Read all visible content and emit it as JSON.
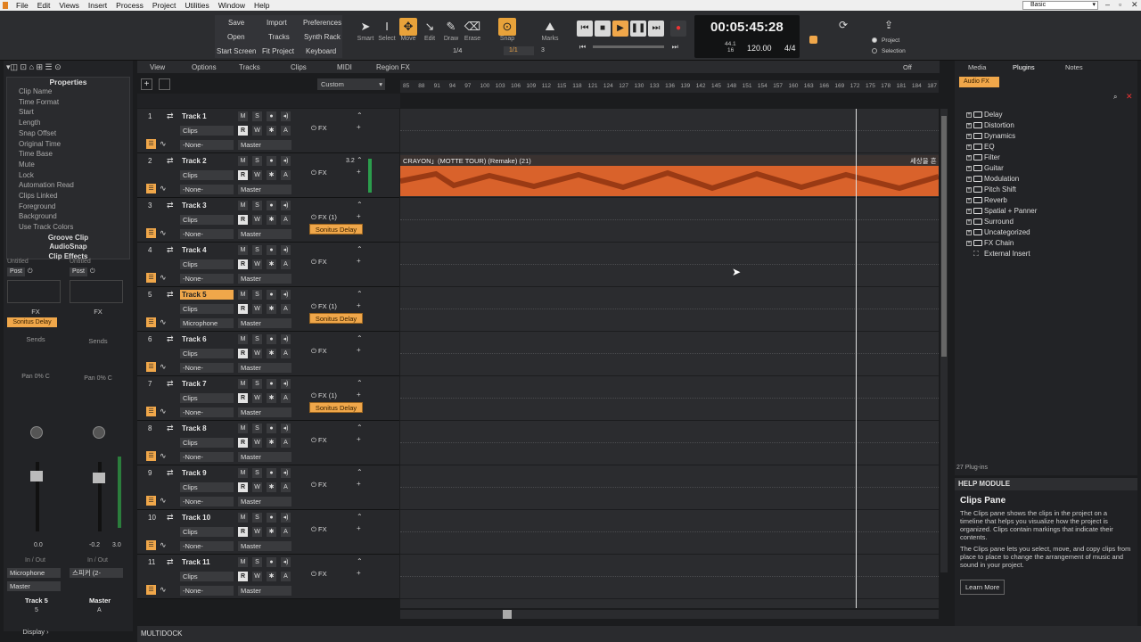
{
  "menu": [
    "File",
    "Edit",
    "Views",
    "Insert",
    "Process",
    "Project",
    "Utilities",
    "Window",
    "Help"
  ],
  "workspace": "Basic",
  "toolbar": {
    "buttons": {
      "save": "Save",
      "import": "Import",
      "preferences": "Preferences",
      "open": "Open",
      "tracks": "Tracks",
      "synth_rack": "Synth Rack",
      "start_screen": "Start Screen",
      "fit_project": "Fit Project",
      "keyboard": "Keyboard"
    },
    "tools": [
      "Smart",
      "Select",
      "Move",
      "Edit",
      "Draw",
      "Erase"
    ],
    "snap_label": "Snap",
    "snap_value": "1/4",
    "snap_value2": "1/1",
    "snap_num": "3",
    "markers_label": "Marks",
    "time": "00:05:45:28",
    "sample_rate": "44.1",
    "bit_depth": "16",
    "tempo": "120.00",
    "meter": "4/4",
    "project_label": "Project",
    "selection_label": "Selection"
  },
  "inspector": {
    "heading": "Properties",
    "properties": [
      "Clip Name",
      "Time Format",
      "Start",
      "Length",
      "Snap Offset",
      "Original Time",
      "Time Base",
      "Mute",
      "Lock",
      "Automation Read",
      "Clips Linked",
      "Foreground",
      "Background",
      "Use Track Colors"
    ],
    "sections": [
      "Groove Clip",
      "AudioSnap",
      "Clip Effects"
    ],
    "strip1": {
      "title": "Untitled",
      "post": "Post",
      "fx": "FX",
      "plugin": "Sonitus Delay",
      "sends": "Sends",
      "pan_label": "Pan",
      "pan_value": "0% C",
      "vol": "0.0",
      "io": "In / Out",
      "input": "Microphone",
      "output": "Master",
      "name": "Track 5",
      "num": "5"
    },
    "strip2": {
      "title": "Untitled",
      "post": "Post",
      "fx": "FX",
      "sends": "Sends",
      "pan_label": "Pan",
      "pan_value": "0% C",
      "vol_l": "-0.2",
      "vol_r": "3.0",
      "io": "In / Out",
      "input": "스피커 (2-",
      "name": "Master",
      "num": "A"
    },
    "display_label": "Display"
  },
  "trackview_menu": [
    "View",
    "Options",
    "Tracks",
    "Clips",
    "MIDI",
    "Region FX"
  ],
  "trackview_preset": "Custom",
  "off_label": "Off",
  "ruler": [
    "85",
    "88",
    "91",
    "94",
    "97",
    "100",
    "103",
    "106",
    "109",
    "112",
    "115",
    "118",
    "121",
    "124",
    "127",
    "130",
    "133",
    "136",
    "139",
    "142",
    "145",
    "148",
    "151",
    "154",
    "157",
    "160",
    "163",
    "166",
    "169",
    "172",
    "175",
    "178",
    "181",
    "184",
    "187"
  ],
  "tracks": [
    {
      "num": "1",
      "name": "Track 1",
      "fx": "FX",
      "input": "-None-",
      "output": "Master",
      "clips": "Clips",
      "plugin": ""
    },
    {
      "num": "2",
      "name": "Track 2",
      "fx": "FX",
      "input": "-None-",
      "output": "Master",
      "clips": "Clips",
      "plugin": "",
      "peak": "3.2"
    },
    {
      "num": "3",
      "name": "Track 3",
      "fx": "FX (1)",
      "input": "-None-",
      "output": "Master",
      "clips": "Clips",
      "plugin": "Sonitus Delay"
    },
    {
      "num": "4",
      "name": "Track 4",
      "fx": "FX",
      "input": "-None-",
      "output": "Master",
      "clips": "Clips",
      "plugin": ""
    },
    {
      "num": "5",
      "name": "Track 5",
      "fx": "FX (1)",
      "input": "Microphone",
      "output": "Master",
      "clips": "Clips",
      "plugin": "Sonitus Delay",
      "selected": true
    },
    {
      "num": "6",
      "name": "Track 6",
      "fx": "FX",
      "input": "-None-",
      "output": "Master",
      "clips": "Clips",
      "plugin": ""
    },
    {
      "num": "7",
      "name": "Track 7",
      "fx": "FX (1)",
      "input": "-None-",
      "output": "Master",
      "clips": "Clips",
      "plugin": "Sonitus Delay"
    },
    {
      "num": "8",
      "name": "Track 8",
      "fx": "FX",
      "input": "-None-",
      "output": "Master",
      "clips": "Clips",
      "plugin": ""
    },
    {
      "num": "9",
      "name": "Track 9",
      "fx": "FX",
      "input": "-None-",
      "output": "Master",
      "clips": "Clips",
      "plugin": ""
    },
    {
      "num": "10",
      "name": "Track 10",
      "fx": "FX",
      "input": "-None-",
      "output": "Master",
      "clips": "Clips",
      "plugin": ""
    },
    {
      "num": "11",
      "name": "Track 11",
      "fx": "FX",
      "input": "-None-",
      "output": "Master",
      "clips": "Clips",
      "plugin": ""
    }
  ],
  "clip": {
    "title": "CRAYON」(MOTTE TOUR) (Remake) (21)",
    "title2": "세상을 흔",
    "color": "#d9622b"
  },
  "multidock_label": "MULTIDOCK",
  "browser": {
    "tabs": [
      "Media",
      "Plugins",
      "Notes"
    ],
    "filter": "Audio FX",
    "items": [
      "Delay",
      "Distortion",
      "Dynamics",
      "EQ",
      "Filter",
      "Guitar",
      "Modulation",
      "Pitch Shift",
      "Reverb",
      "Spatial + Panner",
      "Surround",
      "Uncategorized",
      "FX Chain",
      "External Insert"
    ],
    "count": "27 Plug-ins"
  },
  "help": {
    "header": "HELP MODULE",
    "title": "Clips Pane",
    "p1": "The Clips pane shows the clips in the project on a timeline that helps you visualize how the project is organized. Clips contain markings that indicate their contents.",
    "p2": "The Clips pane lets you select, move, and copy clips from place to place to change the arrangement of music and sound in your project.",
    "button": "Learn More"
  },
  "colors": {
    "accent": "#f0a74a",
    "clip": "#d9622b",
    "bg": "#1b1c1e"
  }
}
